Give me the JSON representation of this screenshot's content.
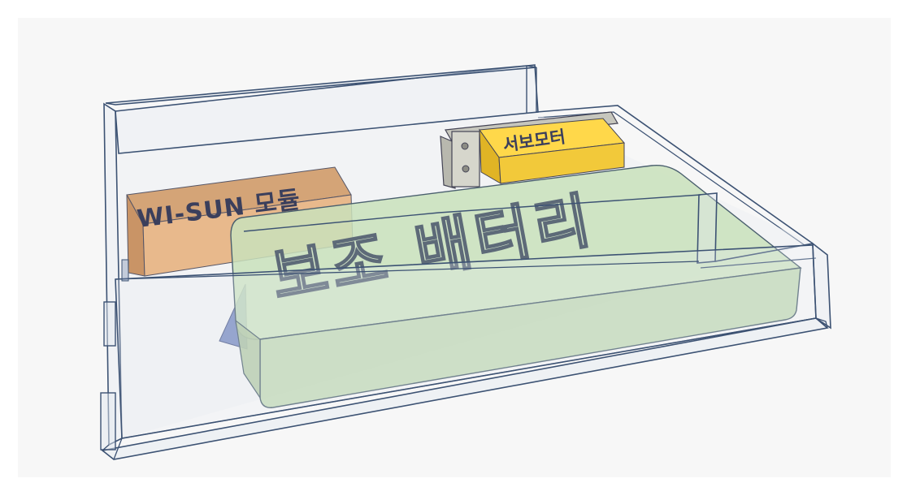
{
  "scene": {
    "background_color": "#f7f7f7",
    "outline_color": "#3c5273",
    "components": {
      "wisun_module": {
        "label": "WI-SUN 모듈",
        "color": "#e8b98c"
      },
      "servo_motor": {
        "label": "서보모터",
        "color": "#f2c93a"
      },
      "battery": {
        "label": "보조 배터리",
        "color": "#c9e0bb"
      }
    }
  }
}
